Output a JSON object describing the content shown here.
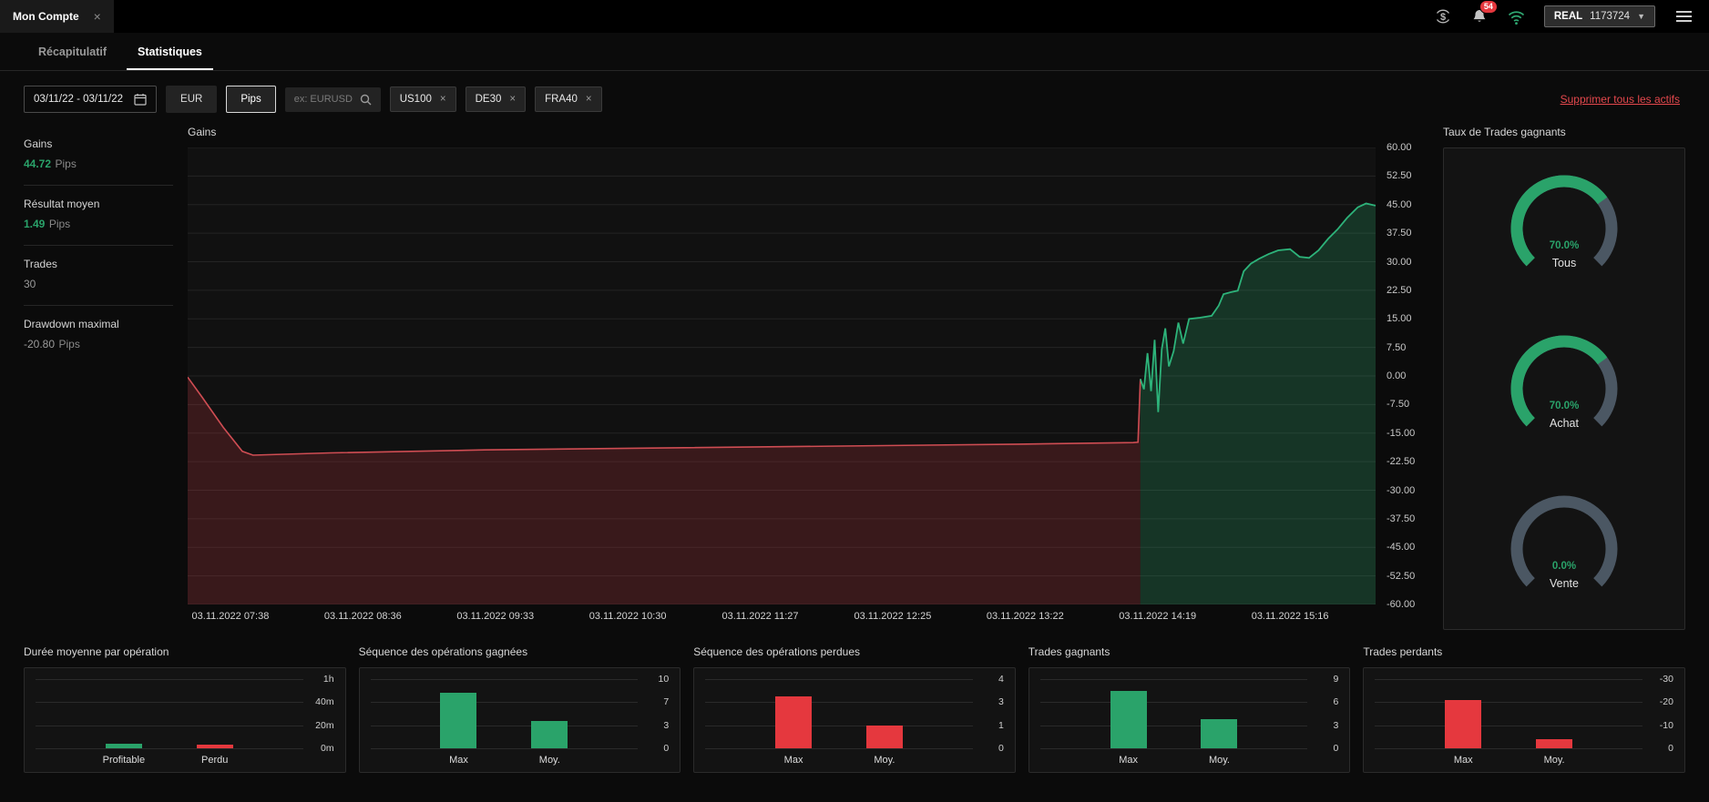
{
  "colors": {
    "green": "#2aa36a",
    "red": "#e5383e",
    "line_red": "#cf4d53",
    "line_green": "#2db37a",
    "fill_red": "rgba(200,55,62,0.22)",
    "fill_green": "rgba(42,170,110,0.24)",
    "gauge_gray": "#4b5763"
  },
  "topbar": {
    "tab_title": "Mon Compte",
    "close": "×",
    "notifications_count": "54",
    "account_type": "REAL",
    "account_number": "1173724"
  },
  "tabs": [
    {
      "label": "Récapitulatif",
      "active": false
    },
    {
      "label": "Statistiques",
      "active": true
    }
  ],
  "filters": {
    "date_range": "03/11/22 - 03/11/22",
    "currency_button": "EUR",
    "unit_button": "Pips",
    "search_placeholder": "ex: EURUSD",
    "chips": [
      {
        "label": "US100",
        "remove": "×"
      },
      {
        "label": "DE30",
        "remove": "×"
      },
      {
        "label": "FRA40",
        "remove": "×"
      }
    ],
    "remove_all_link": "Supprimer tous les actifs"
  },
  "summary_stats": [
    {
      "label": "Gains",
      "value": "44.72",
      "unit": "Pips",
      "highlight": true
    },
    {
      "label": "Résultat moyen",
      "value": "1.49",
      "unit": "Pips",
      "highlight": true
    },
    {
      "label": "Trades",
      "value": "30",
      "unit": "",
      "highlight": false
    },
    {
      "label": "Drawdown maximal",
      "value": "-20.80",
      "unit": "Pips",
      "highlight": false
    }
  ],
  "chart_data": [
    {
      "type": "area",
      "title": "Gains",
      "ylabel": "Pips",
      "ylim": [
        -60,
        60
      ],
      "yticks": [
        "60.00",
        "52.50",
        "45.00",
        "37.50",
        "30.00",
        "22.50",
        "15.00",
        "7.50",
        "0.00",
        "-7.50",
        "-15.00",
        "-22.50",
        "-30.00",
        "-37.50",
        "-45.00",
        "-52.50",
        "-60.00"
      ],
      "xticks": [
        "03.11.2022 07:38",
        "03.11.2022 08:36",
        "03.11.2022 09:33",
        "03.11.2022 10:30",
        "03.11.2022 11:27",
        "03.11.2022 12:25",
        "03.11.2022 13:22",
        "03.11.2022 14:19",
        "03.11.2022 15:16"
      ],
      "grid": true,
      "final_value": 44.72,
      "split_index": 12,
      "points": [
        [
          0.0,
          -0.3
        ],
        [
          0.012,
          -5.5
        ],
        [
          0.03,
          -13.5
        ],
        [
          0.046,
          -19.8
        ],
        [
          0.055,
          -20.8
        ],
        [
          0.12,
          -20.2
        ],
        [
          0.25,
          -19.4
        ],
        [
          0.4,
          -18.9
        ],
        [
          0.55,
          -18.4
        ],
        [
          0.7,
          -17.9
        ],
        [
          0.796,
          -17.5
        ],
        [
          0.8,
          -17.4
        ],
        [
          0.802,
          -0.8
        ],
        [
          0.805,
          -3.5
        ],
        [
          0.808,
          6.0
        ],
        [
          0.811,
          -4.0
        ],
        [
          0.814,
          9.5
        ],
        [
          0.817,
          -9.5
        ],
        [
          0.82,
          7.0
        ],
        [
          0.823,
          12.5
        ],
        [
          0.826,
          2.5
        ],
        [
          0.83,
          6.5
        ],
        [
          0.834,
          14.0
        ],
        [
          0.838,
          8.5
        ],
        [
          0.843,
          15.0
        ],
        [
          0.852,
          15.3
        ],
        [
          0.862,
          15.8
        ],
        [
          0.868,
          18.5
        ],
        [
          0.872,
          21.5
        ],
        [
          0.878,
          22.0
        ],
        [
          0.884,
          22.4
        ],
        [
          0.889,
          27.5
        ],
        [
          0.895,
          29.5
        ],
        [
          0.902,
          30.8
        ],
        [
          0.91,
          32.0
        ],
        [
          0.918,
          33.0
        ],
        [
          0.928,
          33.3
        ],
        [
          0.936,
          31.3
        ],
        [
          0.944,
          31.0
        ],
        [
          0.952,
          33.0
        ],
        [
          0.96,
          36.0
        ],
        [
          0.968,
          38.5
        ],
        [
          0.976,
          41.5
        ],
        [
          0.985,
          44.3
        ],
        [
          0.992,
          45.3
        ],
        [
          1.0,
          44.72
        ]
      ]
    },
    {
      "type": "gauge",
      "title": "Taux de Trades gagnants",
      "gauges": [
        {
          "label": "Tous",
          "value": 70.0,
          "display": "70.0%"
        },
        {
          "label": "Achat",
          "value": 70.0,
          "display": "70.0%"
        },
        {
          "label": "Vente",
          "value": 0.0,
          "display": "0.0%"
        }
      ]
    },
    {
      "type": "bar",
      "title": "Durée moyenne par opération",
      "categories": [
        "Profitable",
        "Perdu"
      ],
      "values": [
        4,
        3
      ],
      "unit": "min",
      "ymax": 60,
      "yticks": [
        "1h",
        "40m",
        "20m",
        "0m"
      ],
      "bar_colors": [
        "#2aa36a",
        "#e5383e"
      ]
    },
    {
      "type": "bar",
      "title": "Séquence des opérations gagnées",
      "categories": [
        "Max",
        "Moy."
      ],
      "values": [
        8,
        4
      ],
      "ymax": 10,
      "yticks": [
        "10",
        "7",
        "3",
        "0"
      ],
      "bar_colors": [
        "#2aa36a",
        "#2aa36a"
      ]
    },
    {
      "type": "bar",
      "title": "Séquence des opérations perdues",
      "categories": [
        "Max",
        "Moy."
      ],
      "values": [
        3,
        1.3
      ],
      "ymax": 4,
      "yticks": [
        "4",
        "3",
        "1",
        "0"
      ],
      "bar_colors": [
        "#e5383e",
        "#e5383e"
      ]
    },
    {
      "type": "bar",
      "title": "Trades gagnants",
      "categories": [
        "Max",
        "Moy."
      ],
      "values": [
        7.5,
        3.8
      ],
      "ymax": 9,
      "yticks": [
        "9",
        "6",
        "3",
        "0"
      ],
      "bar_colors": [
        "#2aa36a",
        "#2aa36a"
      ]
    },
    {
      "type": "bar",
      "title": "Trades perdants",
      "categories": [
        "Max",
        "Moy."
      ],
      "values": [
        -20.8,
        -4.1
      ],
      "ymax": 30,
      "yticks": [
        "-30",
        "-20",
        "-10",
        "0"
      ],
      "bar_colors": [
        "#e5383e",
        "#e5383e"
      ]
    }
  ]
}
